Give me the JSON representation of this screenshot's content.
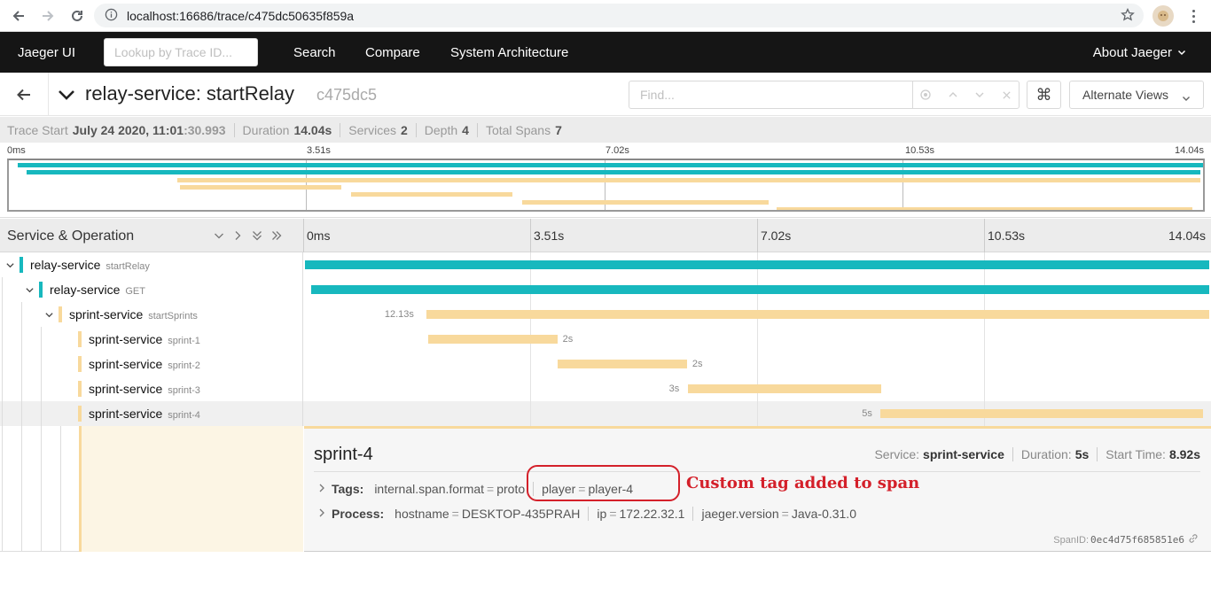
{
  "browser": {
    "url": "localhost:16686/trace/c475dc50635f859a"
  },
  "topnav": {
    "brand": "Jaeger UI",
    "lookup_placeholder": "Lookup by Trace ID...",
    "links": [
      "Search",
      "Compare",
      "System Architecture"
    ],
    "about": "About Jaeger"
  },
  "header": {
    "service": "relay-service: startRelay",
    "trace_id": "c475dc5",
    "find_placeholder": "Find...",
    "alternate_views": "Alternate Views"
  },
  "summary": {
    "trace_start_label": "Trace Start",
    "trace_start_date": "July 24 2020, 11:01",
    "trace_start_secs": ":30.993",
    "duration_label": "Duration",
    "duration": "14.04s",
    "services_label": "Services",
    "services": "2",
    "depth_label": "Depth",
    "depth": "4",
    "total_spans_label": "Total Spans",
    "total_spans": "7"
  },
  "minimap": {
    "ticks": [
      "0ms",
      "3.51s",
      "7.02s",
      "10.53s",
      "14.04s"
    ]
  },
  "timeline": {
    "left_title": "Service & Operation",
    "ticks": [
      "0ms",
      "3.51s",
      "7.02s",
      "10.53s",
      "14.04s"
    ],
    "total_s": 14.04
  },
  "spans": [
    {
      "service": "relay-service",
      "operation": "startRelay",
      "depth": 0,
      "color": "#17b8be",
      "start": 0,
      "duration": 14.04,
      "label": ""
    },
    {
      "service": "relay-service",
      "operation": "GET",
      "depth": 1,
      "color": "#17b8be",
      "start": 0.1,
      "duration": 13.91,
      "label": ""
    },
    {
      "service": "sprint-service",
      "operation": "startSprints",
      "depth": 2,
      "color": "#f8d99c",
      "start": 1.88,
      "duration": 12.13,
      "label": "12.13s"
    },
    {
      "service": "sprint-service",
      "operation": "sprint-1",
      "depth": 3,
      "color": "#f8d99c",
      "start": 1.91,
      "duration": 2.0,
      "label": "2s"
    },
    {
      "service": "sprint-service",
      "operation": "sprint-2",
      "depth": 3,
      "color": "#f8d99c",
      "start": 3.92,
      "duration": 2.0,
      "label": "2s"
    },
    {
      "service": "sprint-service",
      "operation": "sprint-3",
      "depth": 3,
      "color": "#f8d99c",
      "start": 5.93,
      "duration": 3.0,
      "label": "3s"
    },
    {
      "service": "sprint-service",
      "operation": "sprint-4",
      "depth": 3,
      "color": "#f8d99c",
      "start": 8.92,
      "duration": 5.0,
      "label": "5s"
    }
  ],
  "detail": {
    "title": "sprint-4",
    "service_label": "Service:",
    "service": "sprint-service",
    "duration_label": "Duration:",
    "duration": "5s",
    "start_label": "Start Time:",
    "start": "8.92s",
    "tags_label": "Tags:",
    "tags": [
      {
        "key": "internal.span.format",
        "value": "proto"
      },
      {
        "key": "player",
        "value": "player-4"
      }
    ],
    "process_label": "Process:",
    "process": [
      {
        "key": "hostname",
        "value": "DESKTOP-435PRAH"
      },
      {
        "key": "ip",
        "value": "172.22.32.1"
      },
      {
        "key": "jaeger.version",
        "value": "Java-0.31.0"
      }
    ],
    "span_id_label": "SpanID:",
    "span_id": "0ec4d75f685851e6"
  },
  "annotation": {
    "text": "Custom tag added to span",
    "color": "#d4202a"
  },
  "colors": {
    "relay": "#17b8be",
    "sprint": "#f8d99c",
    "nav": "#151515"
  }
}
